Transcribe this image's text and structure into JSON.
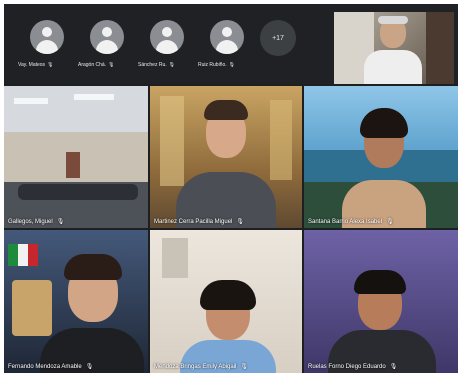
{
  "top_strip": {
    "participants": [
      {
        "name": "Vay. Mateos",
        "mic_icon": "mic-off-icon"
      },
      {
        "name": "Aragón Chá.",
        "mic_icon": "mic-off-icon"
      },
      {
        "name": "Sánchez Ru.",
        "mic_icon": "mic-off-icon"
      },
      {
        "name": "Ruiz Rubiño.",
        "mic_icon": "mic-off-icon"
      }
    ],
    "more_count": "+17"
  },
  "grid": {
    "tiles": [
      {
        "name": "Gallegos, Miguel"
      },
      {
        "name": "Martinez Cerra Pacilla Miguel"
      },
      {
        "name": "Santana Barrio Alexa Isabel"
      },
      {
        "name": "Fernando Mendoza Amable"
      },
      {
        "name": "Mendoza Bringas Emily Abigail"
      },
      {
        "name": "Ruelas Forno Diego Eduardo"
      }
    ]
  },
  "colors": {
    "background": "#1e1f21",
    "label_text": "#ffffff",
    "avatar_circle": "#8a8d92"
  }
}
